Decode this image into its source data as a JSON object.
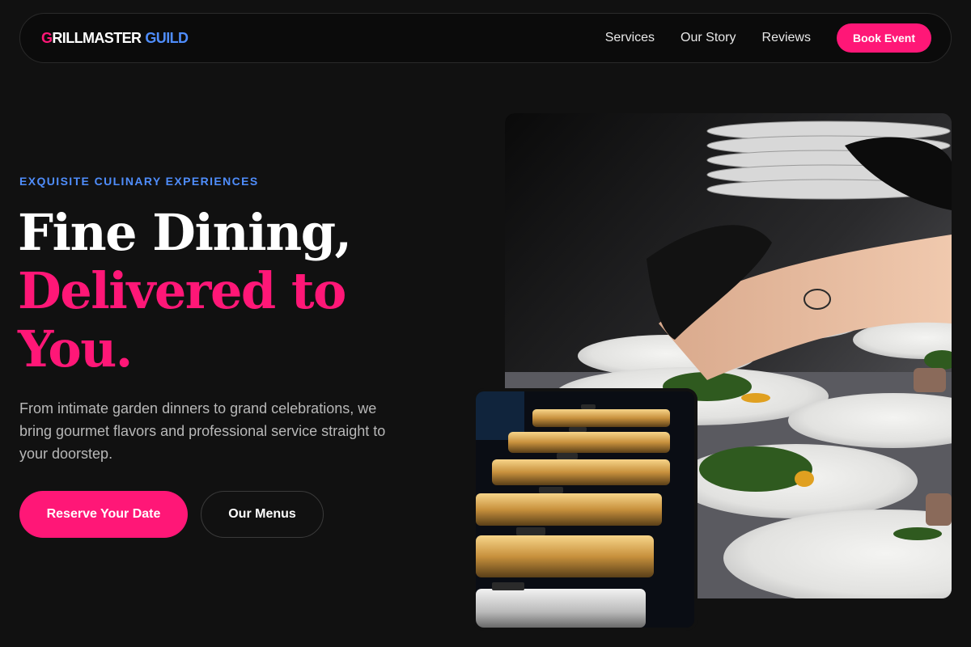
{
  "brand": {
    "first_letter": "G",
    "rest": "RILLMASTER",
    "accent": "GUILD"
  },
  "nav": {
    "links": [
      "Services",
      "Our Story",
      "Reviews"
    ],
    "cta": "Book Event"
  },
  "hero": {
    "eyebrow": "EXQUISITE CULINARY EXPERIENCES",
    "headline_line1": "Fine Dining,",
    "headline_line2": "Delivered to",
    "headline_line3": "You.",
    "subtext": "From intimate garden dinners to grand celebrations, we bring gourmet flavors and professional service straight to your doorstep.",
    "primary_button": "Reserve Your Date",
    "secondary_button": "Our Menus"
  },
  "images": {
    "main_alt": "Chef plating dishes",
    "small_alt": "Chafing dishes at buffet"
  },
  "colors": {
    "accent_pink": "#ff1777",
    "accent_blue": "#4f8dfb",
    "background": "#111111"
  }
}
